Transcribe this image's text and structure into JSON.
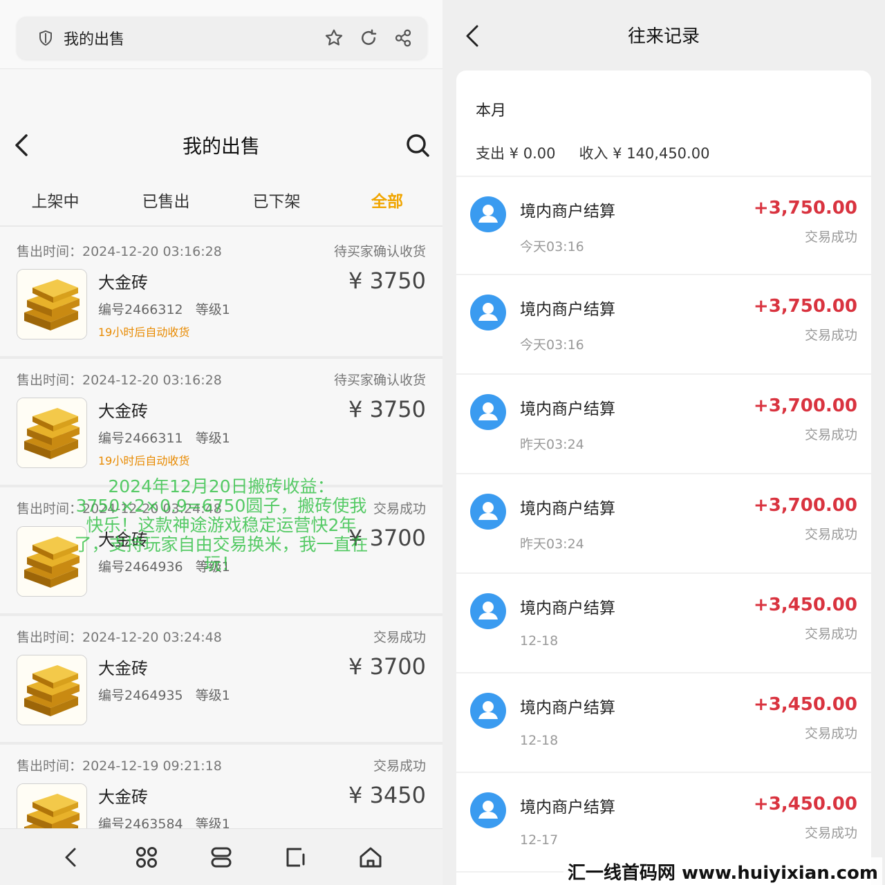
{
  "left": {
    "browser": {
      "title": "我的出售",
      "icons": [
        "shield-icon",
        "star-icon",
        "refresh-icon",
        "share-icon"
      ]
    },
    "appbar": {
      "title": "我的出售"
    },
    "tabs": [
      "上架中",
      "已售出",
      "已下架",
      "全部"
    ],
    "active_tab": "全部",
    "orders": [
      {
        "time": "售出时间：2024-12-20 03:16:28",
        "status": "待买家确认收货",
        "name": "大金砖",
        "price": "¥ 3750",
        "id": "编号2466312",
        "level": "等级1",
        "auto": "19小时后自动收货"
      },
      {
        "time": "售出时间：2024-12-20 03:16:28",
        "status": "待买家确认收货",
        "name": "大金砖",
        "price": "¥ 3750",
        "id": "编号2466311",
        "level": "等级1",
        "auto": "19小时后自动收货"
      },
      {
        "time": "售出时间：2024-12-20 03:24:48",
        "status": "交易成功",
        "name": "大金砖",
        "price": "¥ 3700",
        "id": "编号2464936",
        "level": "等级1",
        "auto": ""
      },
      {
        "time": "售出时间：2024-12-20 03:24:48",
        "status": "交易成功",
        "name": "大金砖",
        "price": "¥ 3700",
        "id": "编号2464935",
        "level": "等级1",
        "auto": ""
      },
      {
        "time": "售出时间：2024-12-19 09:21:18",
        "status": "交易成功",
        "name": "大金砖",
        "price": "¥ 3450",
        "id": "编号2463584",
        "level": "等级1",
        "auto": ""
      }
    ],
    "overlay": "2024年12月20日搬砖收益：3750×2×0.9=6750圆子，搬砖使我快乐！这款神途游戏稳定运营快2年了，支持玩家自由交易换米，我一直在玩！",
    "bottom_nav": [
      "back-icon",
      "apps-icon",
      "tabs-icon",
      "edit-icon",
      "home-icon"
    ]
  },
  "right": {
    "title": "往来记录",
    "month": "本月",
    "expense": "支出 ¥ 0.00",
    "income": "收入 ¥ 140,450.00",
    "records": [
      {
        "name": "境内商户结算",
        "date": "今天03:16",
        "amount": "+3,750.00",
        "status": "交易成功"
      },
      {
        "name": "境内商户结算",
        "date": "今天03:16",
        "amount": "+3,750.00",
        "status": "交易成功"
      },
      {
        "name": "境内商户结算",
        "date": "昨天03:24",
        "amount": "+3,700.00",
        "status": "交易成功"
      },
      {
        "name": "境内商户结算",
        "date": "昨天03:24",
        "amount": "+3,700.00",
        "status": "交易成功"
      },
      {
        "name": "境内商户结算",
        "date": "12-18",
        "amount": "+3,450.00",
        "status": "交易成功"
      },
      {
        "name": "境内商户结算",
        "date": "12-18",
        "amount": "+3,450.00",
        "status": "交易成功"
      },
      {
        "name": "境内商户结算",
        "date": "12-17",
        "amount": "+3,450.00",
        "status": "交易成功"
      }
    ]
  },
  "watermark": "汇一线首码网 www.huiyixian.com",
  "colors": {
    "accent_tab": "#f0a500",
    "amount_red": "#d9333f",
    "avatar_blue": "#3a9bf0",
    "auto_orange": "#e88a00",
    "overlay_green": "#28be3c"
  }
}
